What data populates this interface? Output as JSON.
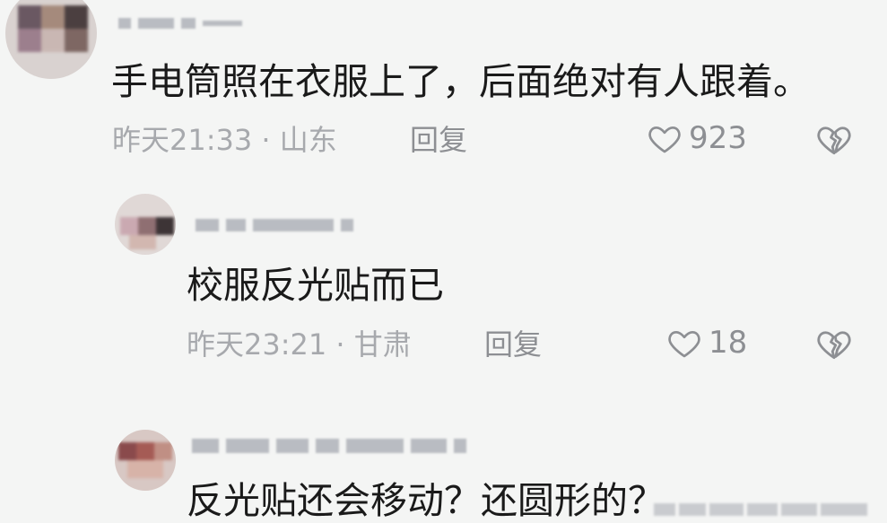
{
  "comments": [
    {
      "text": "手电筒照在衣服上了，后面绝对有人跟着。",
      "meta": "昨天21:33 · 山东",
      "reply_label": "回复",
      "likes": "923"
    },
    {
      "text": "校服反光贴而已",
      "meta": "昨天23:21 · 甘肃",
      "reply_label": "回复",
      "likes": "18"
    },
    {
      "text": "反光贴还会移动？还圆形的？"
    }
  ],
  "icons": {
    "like": "heart-outline-icon",
    "dislike": "broken-heart-icon"
  },
  "colors": {
    "background": "#f4f5f4",
    "text": "#1a1a1a",
    "meta": "#a7a9ad",
    "action": "#8d8f93"
  }
}
